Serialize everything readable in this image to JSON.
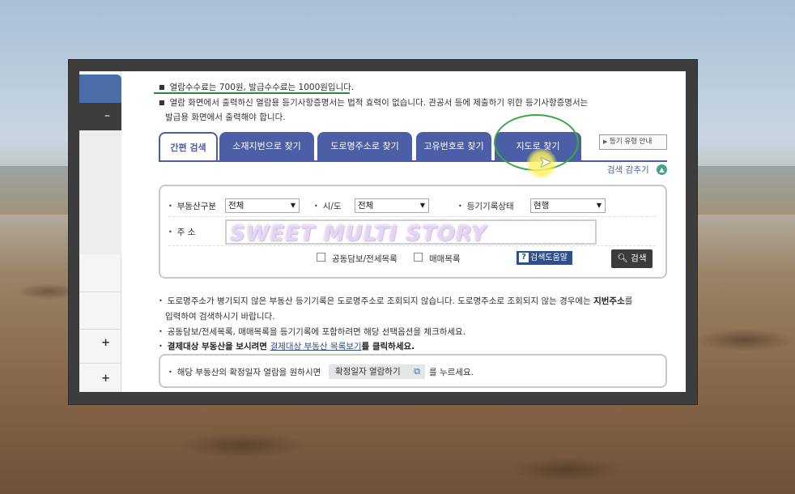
{
  "notice": {
    "fee_line": "열람수수료는 700원, 발급수수료는 1000원입니다.",
    "legal_line1": "열람 화면에서 출력하신 열람용 등기사항증명서는 법적 효력이 없습니다. 관공서 등에 제출하기 위한 등기사항증명서는",
    "legal_line2": "발급용 화면에서 출력해야 합니다."
  },
  "tabs": [
    {
      "label": "간편 검색",
      "active": true
    },
    {
      "label": "소재지번으로 찾기"
    },
    {
      "label": "도로명주소로 찾기"
    },
    {
      "label": "고유번호로 찾기"
    },
    {
      "label": "지도로 찾기"
    }
  ],
  "guide_button": "등기 유형 안내",
  "fold_label": "검색 감추기",
  "form": {
    "property_type_label": "부동산구분",
    "property_type_value": "전체",
    "region_label": "시/도",
    "region_value": "전체",
    "record_status_label": "등기기록상태",
    "record_status_value": "현행",
    "address_label": "주 소",
    "address_value": "",
    "joint_collateral_label": "공동담보/전세목록",
    "sale_list_label": "매매목록",
    "help_button": "검색도움말",
    "search_button": "검색"
  },
  "watermark": "SWEET MULTI STORY",
  "info": {
    "line1_pre": "도로명주소가 병기되지 않은 부동산 등기기록은 도로명주소로 조회되지 않습니다. 도로명주소로 조회되지 않는 경우에는 ",
    "line1_bold": "지번주소",
    "line1_post": "를",
    "line2": "입력하여 검색하시기 바랍니다.",
    "line3": "공동담보/전세목록, 매매목록을 등기기록에 포함하려면 해당 선택옵션을 체크하세요.",
    "line4_pre": "결제대상 부동산을 보시려면 ",
    "line4_link": "결제대상 부동산 목록보기",
    "line4_post": "를 클릭하세요."
  },
  "confirm": {
    "pre": "해당 부동산의 확정일자 열람을 원하시면",
    "button": "확정일자 열람하기",
    "post": "를 누르세요."
  },
  "sidebar": {
    "collapse_symbol": "–",
    "expand_symbol_1": "+",
    "expand_symbol_2": "+"
  },
  "colors": {
    "tab_blue": "#4b5ea6",
    "annotation_green": "#3aa84a",
    "search_dark": "#3b3b3b"
  }
}
